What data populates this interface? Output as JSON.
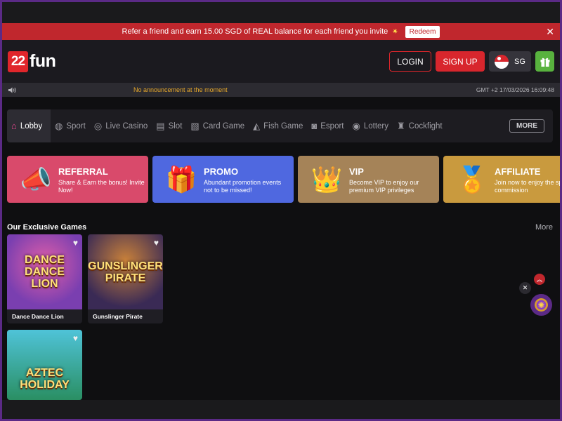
{
  "referral_bar": {
    "text": "Refer a friend and earn 15.00 SGD of REAL balance for each friend you invite",
    "star": "✷",
    "redeem_label": "Redeem",
    "close": "✕"
  },
  "header": {
    "logo_mark": "22",
    "logo_text": "fun",
    "login_label": "LOGIN",
    "signup_label": "SIGN UP",
    "region_label": "SG"
  },
  "announcement": {
    "text": "No announcement at the moment",
    "datetime": "GMT +2 17/03/2026 16:09:48"
  },
  "nav": {
    "items": [
      {
        "label": "Lobby",
        "icon": "home-icon",
        "glyph": "⌂"
      },
      {
        "label": "Sport",
        "icon": "ball-icon",
        "glyph": "◍"
      },
      {
        "label": "Live Casino",
        "icon": "chip-icon",
        "glyph": "◎"
      },
      {
        "label": "Slot",
        "icon": "slot-machine-icon",
        "glyph": "▤"
      },
      {
        "label": "Card Game",
        "icon": "cards-icon",
        "glyph": "▧"
      },
      {
        "label": "Fish Game",
        "icon": "fish-icon",
        "glyph": "◭"
      },
      {
        "label": "Esport",
        "icon": "gamepad-icon",
        "glyph": "◙"
      },
      {
        "label": "Lottery",
        "icon": "lottery-ball-icon",
        "glyph": "◉"
      },
      {
        "label": "Cockfight",
        "icon": "rooster-icon",
        "glyph": "♜"
      }
    ],
    "more_label": "MORE"
  },
  "promo_cards": [
    {
      "title": "REFERRAL",
      "subtitle": "Share & Earn the bonus! Invite Now!",
      "icon": "megaphone-icon",
      "glyph": "📣",
      "color": "#d94a6b"
    },
    {
      "title": "PROMO",
      "subtitle": "Abundant promotion events not to be missed!",
      "icon": "gift-box-icon",
      "glyph": "🎁",
      "color": "#4f68e0"
    },
    {
      "title": "VIP",
      "subtitle": "Become VIP to enjoy our premium VIP privileges",
      "icon": "crown-cushion-icon",
      "glyph": "👑",
      "color": "#a58358"
    },
    {
      "title": "AFFILIATE",
      "subtitle": "Join now to enjoy the special commission",
      "icon": "medal-icon",
      "glyph": "🏅",
      "color": "#c99a3e"
    }
  ],
  "games_section": {
    "title": "Our Exclusive Games",
    "more_label": "More",
    "games": [
      {
        "name": "Dance Dance Lion",
        "art_text": "DANCE DANCE LION",
        "bg": "#7a3fb0",
        "heart": "♥"
      },
      {
        "name": "Gunslinger Pirate",
        "art_text": "GUNSLINGER PIRATE",
        "bg": "#5a3a2a",
        "heart": "♥"
      },
      {
        "name": "",
        "art_text": "AZTEC HOLIDAY",
        "bg": "#2aa6b8",
        "heart": "♥"
      }
    ]
  },
  "floating": {
    "close": "✕",
    "up": "︽",
    "wheel": "✺"
  }
}
